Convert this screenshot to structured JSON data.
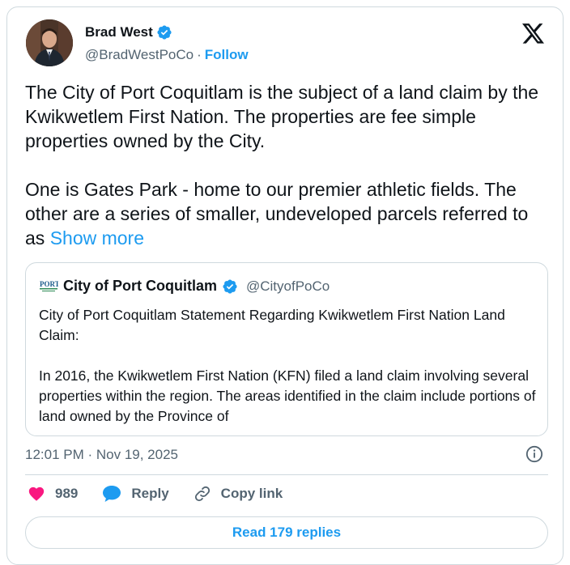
{
  "author": {
    "name": "Brad West",
    "handle": "@BradWestPoCo",
    "separator": "·",
    "follow_label": "Follow"
  },
  "tweet": {
    "text": "The City of Port Coquitlam is the subject of a land claim by the Kwikwetlem First Nation. The properties are fee simple properties owned by the City.\n\nOne is Gates Park - home to our premier athletic fields. The other are a series of smaller, undeveloped parcels referred to as ",
    "show_more_label": "Show more"
  },
  "quote": {
    "logo_text": "PORT",
    "name": "City of Port Coquitlam",
    "handle": "@CityofPoCo",
    "paragraph1": "City of Port Coquitlam Statement Regarding Kwikwetlem First Nation Land Claim:",
    "paragraph2": "In 2016, the Kwikwetlem First Nation (KFN) filed a land claim involving several properties within the region. The areas identified in the claim include portions of land owned by the Province of"
  },
  "timestamp": "12:01 PM · Nov 19, 2025",
  "actions": {
    "likes": "989",
    "reply_label": "Reply",
    "copy_link_label": "Copy link"
  },
  "read_replies_label": "Read 179 replies",
  "colors": {
    "accent": "#1d9bf0",
    "like": "#f91880",
    "secondary_text": "#536471",
    "border": "#cfd9de"
  }
}
